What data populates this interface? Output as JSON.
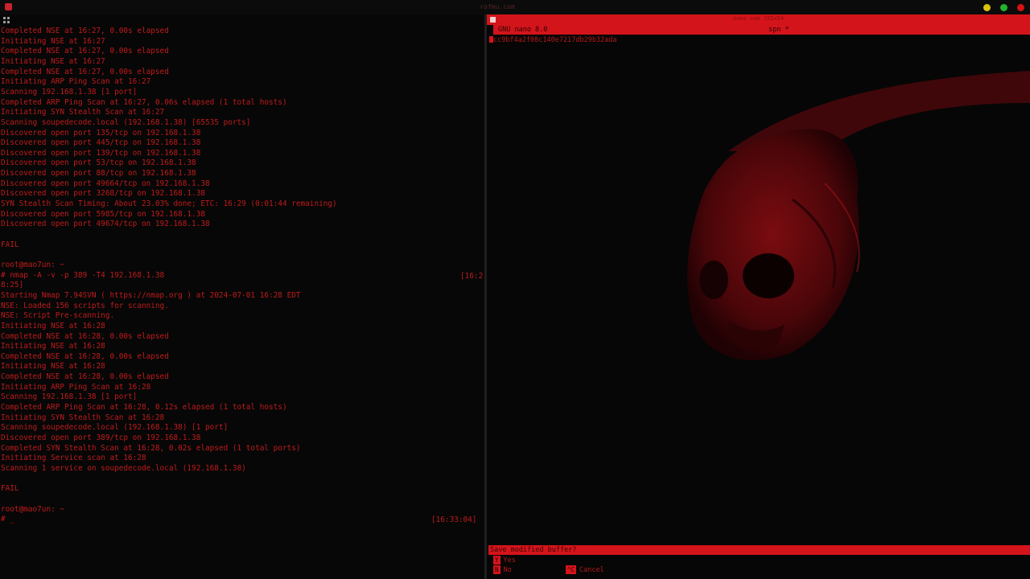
{
  "window": {
    "title": "rofmu.com"
  },
  "terminal": {
    "lines": [
      "Completed NSE at 16:27, 0.00s elapsed",
      "Initiating NSE at 16:27",
      "Completed NSE at 16:27, 0.00s elapsed",
      "Initiating NSE at 16:27",
      "Completed NSE at 16:27, 0.00s elapsed",
      "Initiating ARP Ping Scan at 16:27",
      "Scanning 192.168.1.38 [1 port]",
      "Completed ARP Ping Scan at 16:27, 0.06s elapsed (1 total hosts)",
      "Initiating SYN Stealth Scan at 16:27",
      "Scanning soupedecode.local (192.168.1.38) [65535 ports]",
      "Discovered open port 135/tcp on 192.168.1.38",
      "Discovered open port 445/tcp on 192.168.1.38",
      "Discovered open port 139/tcp on 192.168.1.38",
      "Discovered open port 53/tcp on 192.168.1.38",
      "Discovered open port 88/tcp on 192.168.1.38",
      "Discovered open port 49664/tcp on 192.168.1.38",
      "Discovered open port 3268/tcp on 192.168.1.38",
      "SYN Stealth Scan Timing: About 23.03% done; ETC: 16:29 (0:01:44 remaining)",
      "Discovered open port 5985/tcp on 192.168.1.38",
      "Discovered open port 49674/tcp on 192.168.1.38",
      "",
      "FAIL",
      "",
      "PROMPT",
      "# nmap -A -v -p 389 -T4 192.168.1.38",
      "8:25]",
      "Starting Nmap 7.94SVN ( https://nmap.org ) at 2024-07-01 16:28 EDT",
      "NSE: Loaded 156 scripts for scanning.",
      "NSE: Script Pre-scanning.",
      "Initiating NSE at 16:28",
      "Completed NSE at 16:28, 0.00s elapsed",
      "Initiating NSE at 16:28",
      "Completed NSE at 16:28, 0.00s elapsed",
      "Initiating NSE at 16:28",
      "Completed NSE at 16:28, 0.00s elapsed",
      "Initiating ARP Ping Scan at 16:28",
      "Scanning 192.168.1.38 [1 port]",
      "Completed ARP Ping Scan at 16:28, 0.12s elapsed (1 total hosts)",
      "Initiating SYN Stealth Scan at 16:28",
      "Scanning soupedecode.local (192.168.1.38) [1 port]",
      "Discovered open port 389/tcp on 192.168.1.38",
      "Completed SYN Stealth Scan at 16:28, 0.02s elapsed (1 total ports)",
      "Initiating Service scan at 16:28",
      "Scanning 1 service on soupedecode.local (192.168.1.38)",
      "",
      "FAIL",
      "",
      "PROMPT",
      "# _"
    ],
    "prompt": {
      "user": "root",
      "at": "@",
      "host": "mao7un",
      "sep": ": ~"
    },
    "timestamp_truncated": "[16:2",
    "timestamp_current": "[16:33:04]"
  },
  "nano": {
    "window_title": "nano sam 192x54",
    "app_name": "GNU nano 8.0",
    "file_name": "spn *",
    "buffer_line": "cc9bf4a2f08c140e7217db29b32ada",
    "save_prompt": "Save modified buffer?",
    "options": [
      {
        "key": "Y",
        "label": "Yes"
      },
      {
        "key": "N",
        "label": "No"
      },
      {
        "key": "^C",
        "label": "Cancel"
      }
    ]
  },
  "colors": {
    "accent": "#d4141b",
    "text": "#bf1b1b",
    "background": "#070707"
  }
}
